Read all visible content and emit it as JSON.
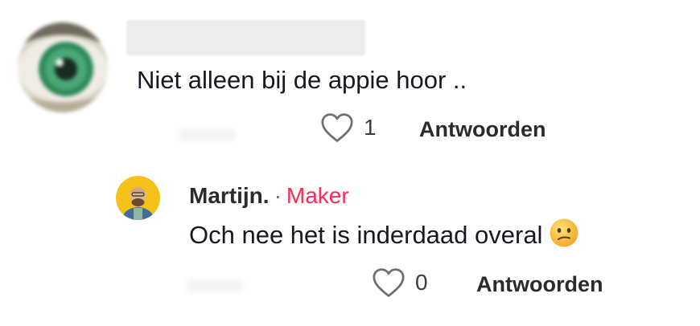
{
  "comment": {
    "text": "Niet alleen bij de appie hoor ..",
    "likes": "1",
    "reply_label": "Antwoorden"
  },
  "reply": {
    "author": "Martijn.",
    "separator": "·",
    "badge": "Maker",
    "text": "Och nee het is inderdaad overal",
    "emoji": "confused-face-icon",
    "likes": "0",
    "reply_label": "Antwoorden"
  },
  "colors": {
    "badge": "#fe2c55",
    "text": "#161823",
    "muted": "#6f6f6f"
  }
}
